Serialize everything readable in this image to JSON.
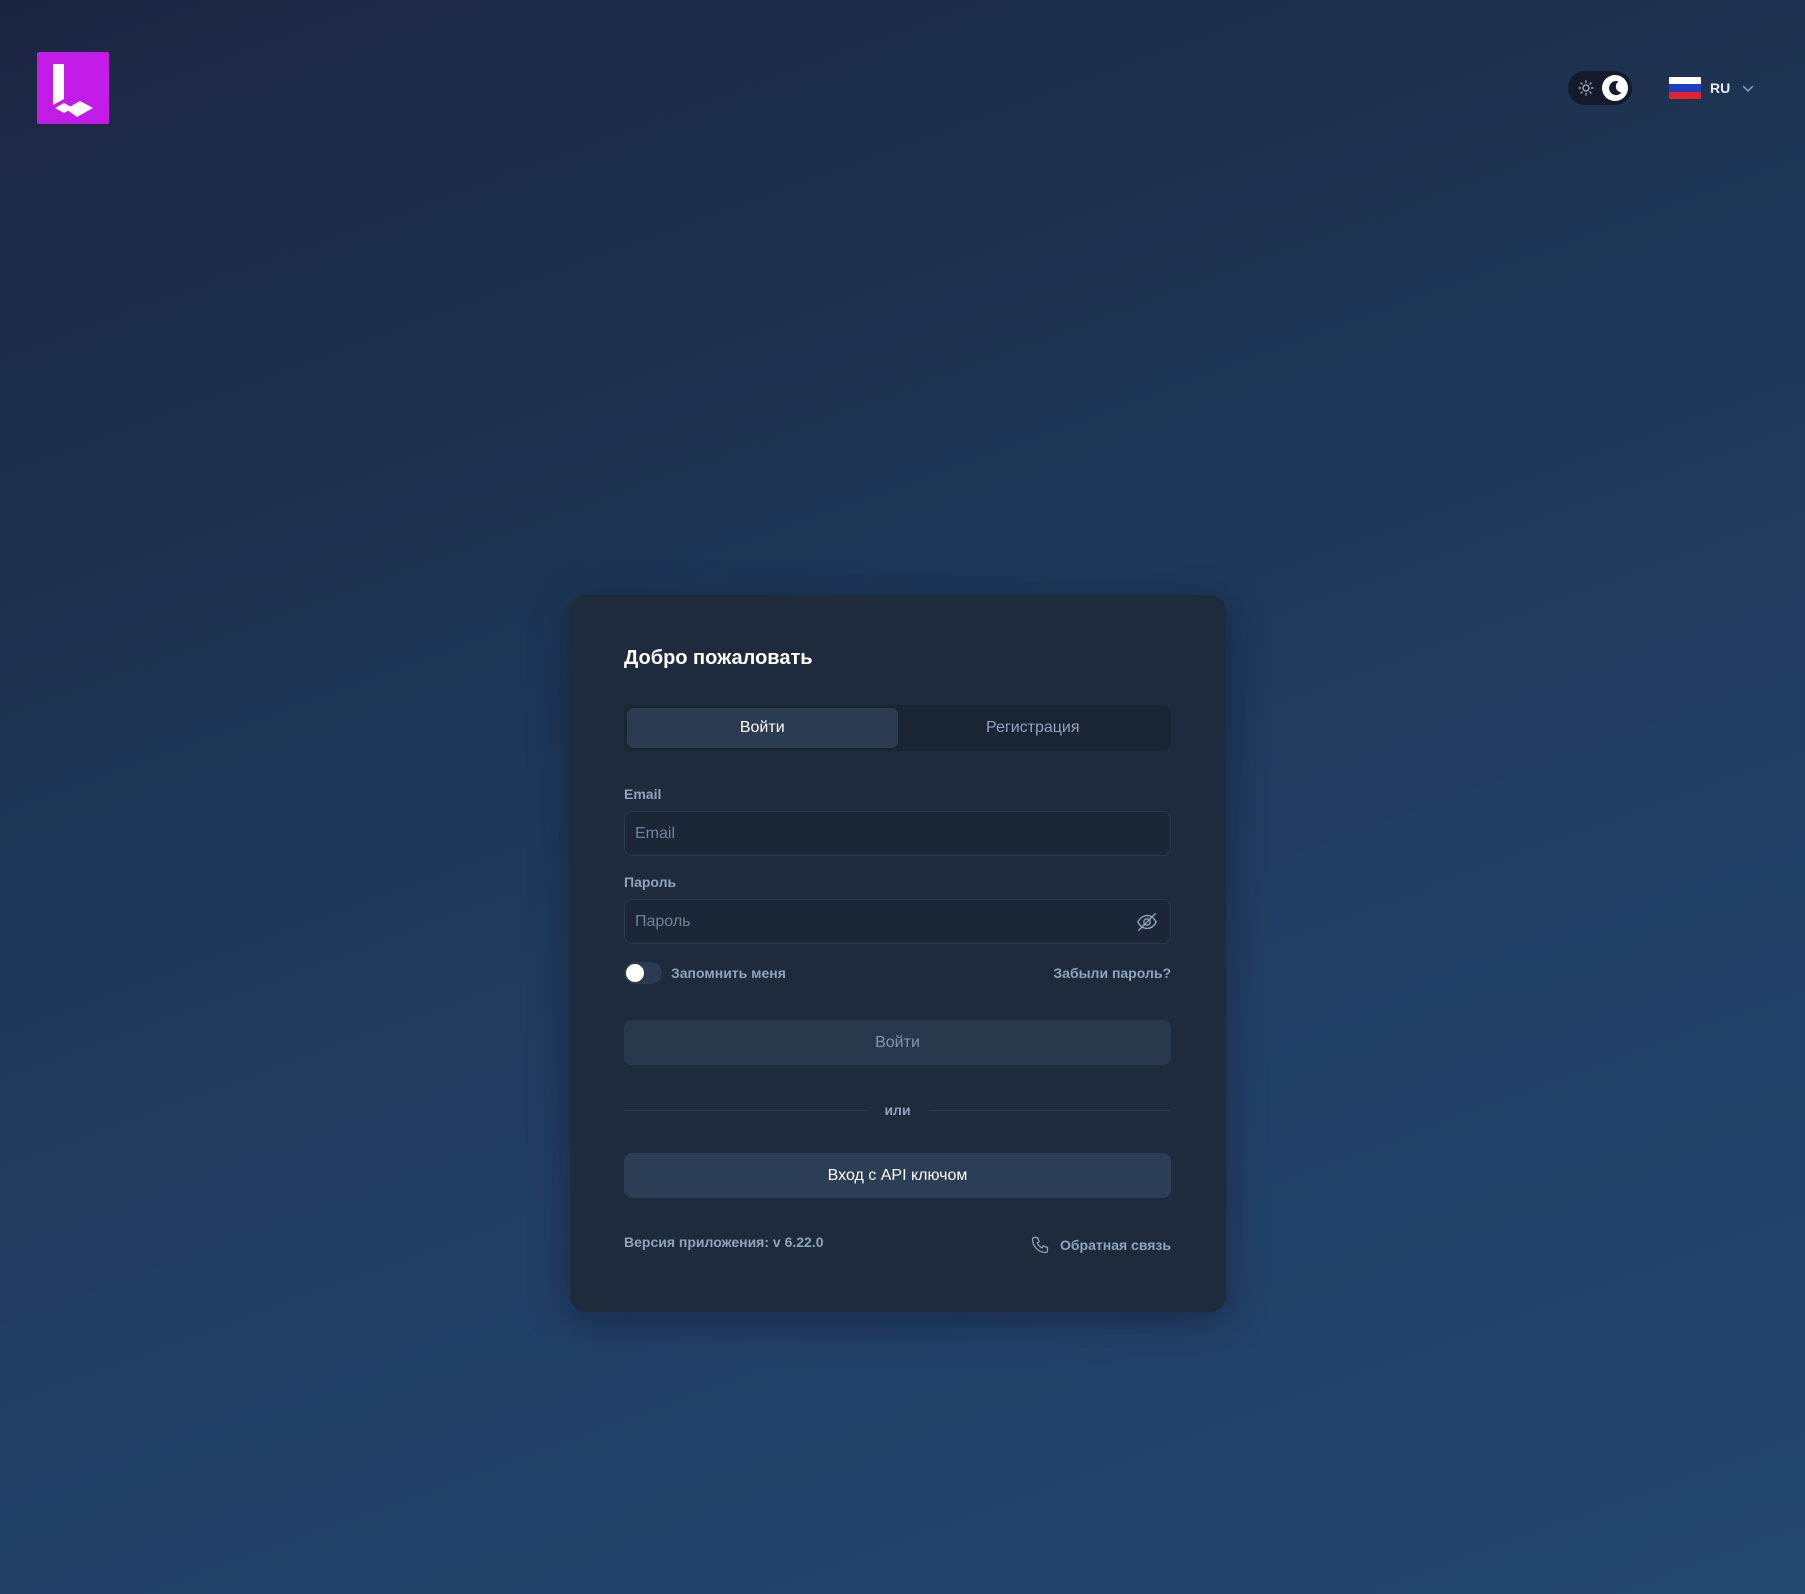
{
  "header": {
    "language_code": "RU",
    "flag_colors": [
      "#ffffff",
      "#1c3fc2",
      "#e3222b"
    ],
    "logo_color": "#c21be8"
  },
  "card": {
    "title": "Добро пожаловать",
    "tabs": [
      {
        "label": "Войти",
        "active": true
      },
      {
        "label": "Регистрация",
        "active": false
      }
    ],
    "email": {
      "label": "Email",
      "placeholder": "Email",
      "value": ""
    },
    "password": {
      "label": "Пароль",
      "placeholder": "Пароль",
      "value": ""
    },
    "remember_label": "Запомнить меня",
    "remember_on": false,
    "forgot_label": "Забыли пароль?",
    "login_button": "Войти",
    "or_label": "или",
    "api_button": "Вход с API ключом",
    "version": "Версия приложения: v 6.22.0",
    "feedback_label": "Обратная связь"
  },
  "icons": {
    "theme_light": "sun-icon",
    "theme_dark": "moon-icon",
    "password_toggle": "eye-off-icon",
    "language_menu": "chevron-down-icon",
    "feedback": "phone-icon"
  }
}
